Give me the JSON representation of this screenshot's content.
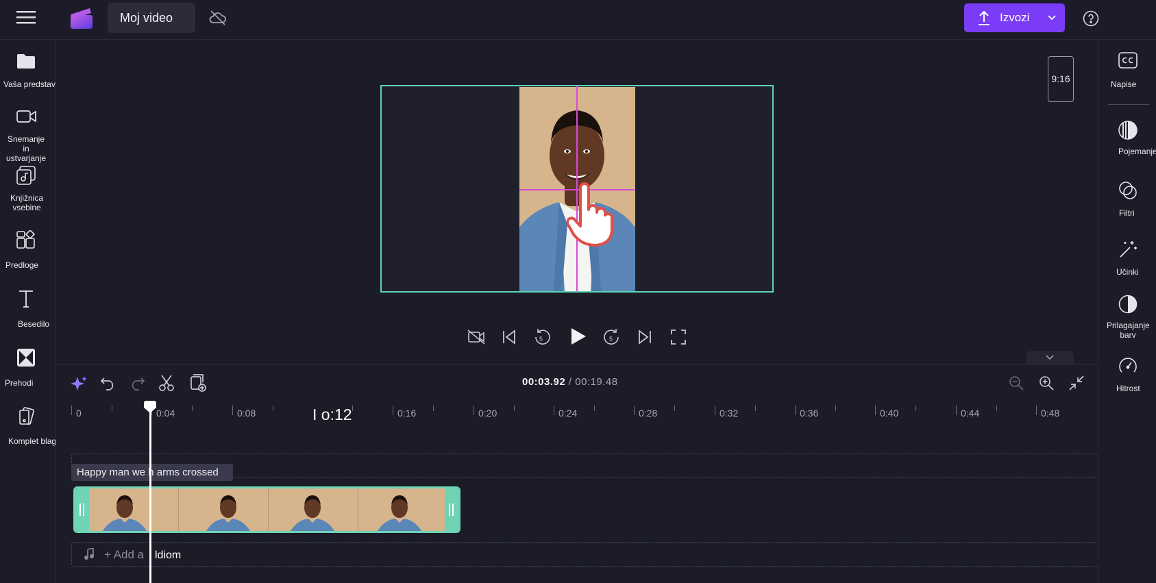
{
  "header": {
    "project_title": "Moj video",
    "export_label": "Izvozi",
    "icons": [
      "hamburger-menu-icon",
      "clipchamp-logo",
      "cloud-off-icon",
      "upload-icon",
      "chevron-down-icon",
      "help-icon"
    ]
  },
  "left_sidebar": {
    "items": [
      {
        "label": "Vaša predstavnost",
        "icon": "folder-icon"
      },
      {
        "label": "Snemanje in ustvarjanje",
        "icon": "camera-icon"
      },
      {
        "label": "Knjižnica vsebine",
        "icon": "content-library-icon"
      },
      {
        "label": "Predloge",
        "icon": "templates-icon"
      },
      {
        "label": "Besedilo",
        "icon": "text-icon"
      },
      {
        "label": "Prehodi",
        "icon": "transitions-icon"
      },
      {
        "label": "Komplet blagovnih znamk",
        "icon": "brand-kit-icon"
      }
    ]
  },
  "right_sidebar": {
    "items": [
      {
        "label": "Napise",
        "icon": "captions-icon"
      },
      {
        "label": "Pojemanje",
        "icon": "fade-icon"
      },
      {
        "label": "Filtri",
        "icon": "filters-icon"
      },
      {
        "label": "Učinki",
        "icon": "effects-icon"
      },
      {
        "label": "Prilagajanje barv",
        "icon": "color-adjust-icon"
      },
      {
        "label": "Hitrost",
        "icon": "speed-icon"
      }
    ]
  },
  "preview": {
    "aspect_ratio": "9:16"
  },
  "timeline": {
    "current_time": "00:03.92",
    "total_time": "/ 00:19.48",
    "ruler_ticks": [
      "0",
      "0:04",
      "0:08",
      "0:16",
      "0:20",
      "0:24",
      "0:28",
      "0:32",
      "0:36",
      "0:40",
      "0:44",
      "0:48"
    ],
    "ruler_overlay_text": "I o:12",
    "clip_name": "Happy man we h arms crossed",
    "audio_placeholder": "+ Add a",
    "audio_overlay_text": "ldiom"
  },
  "colors": {
    "accent": "#7a3cf6",
    "selection": "#5fd3b6",
    "guide": "#d94ad8",
    "background": "#1c1c28"
  }
}
